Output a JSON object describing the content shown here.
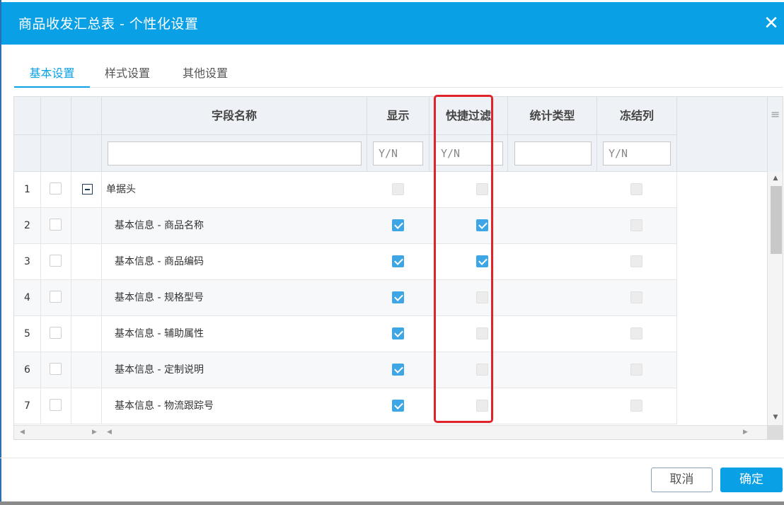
{
  "dialog": {
    "title": "商品收发汇总表 - 个性化设置",
    "close_label": "✕"
  },
  "tabs": [
    {
      "label": "基本设置",
      "active": true
    },
    {
      "label": "样式设置",
      "active": false
    },
    {
      "label": "其他设置",
      "active": false
    }
  ],
  "grid": {
    "headers": {
      "field_name": "字段名称",
      "display": "显示",
      "quick_filter": "快捷过滤",
      "stat_type": "统计类型",
      "freeze": "冻结列"
    },
    "filters": {
      "field_name": "",
      "display": "Y/N",
      "quick_filter": "Y/N",
      "stat_type": "",
      "freeze": "Y/N"
    },
    "rows": [
      {
        "num": "1",
        "name": "单据头",
        "group": true,
        "display": "disabled",
        "quick_filter": "disabled",
        "freeze": "disabled"
      },
      {
        "num": "2",
        "name": "基本信息 - 商品名称",
        "group": false,
        "display": "checked",
        "quick_filter": "checked",
        "freeze": "disabled"
      },
      {
        "num": "3",
        "name": "基本信息 - 商品编码",
        "group": false,
        "display": "checked",
        "quick_filter": "checked",
        "freeze": "disabled"
      },
      {
        "num": "4",
        "name": "基本信息 - 规格型号",
        "group": false,
        "display": "checked",
        "quick_filter": "disabled",
        "freeze": "disabled"
      },
      {
        "num": "5",
        "name": "基本信息 - 辅助属性",
        "group": false,
        "display": "checked",
        "quick_filter": "disabled",
        "freeze": "disabled"
      },
      {
        "num": "6",
        "name": "基本信息 - 定制说明",
        "group": false,
        "display": "checked",
        "quick_filter": "disabled",
        "freeze": "disabled"
      },
      {
        "num": "7",
        "name": "基本信息 - 物流跟踪号",
        "group": false,
        "display": "checked",
        "quick_filter": "disabled",
        "freeze": "disabled"
      }
    ]
  },
  "footer": {
    "cancel_label": "取消",
    "ok_label": "确定"
  },
  "colors": {
    "accent": "#0aa0e6",
    "highlight": "#e0232b",
    "checkbox_checked": "#3ea6e4"
  }
}
